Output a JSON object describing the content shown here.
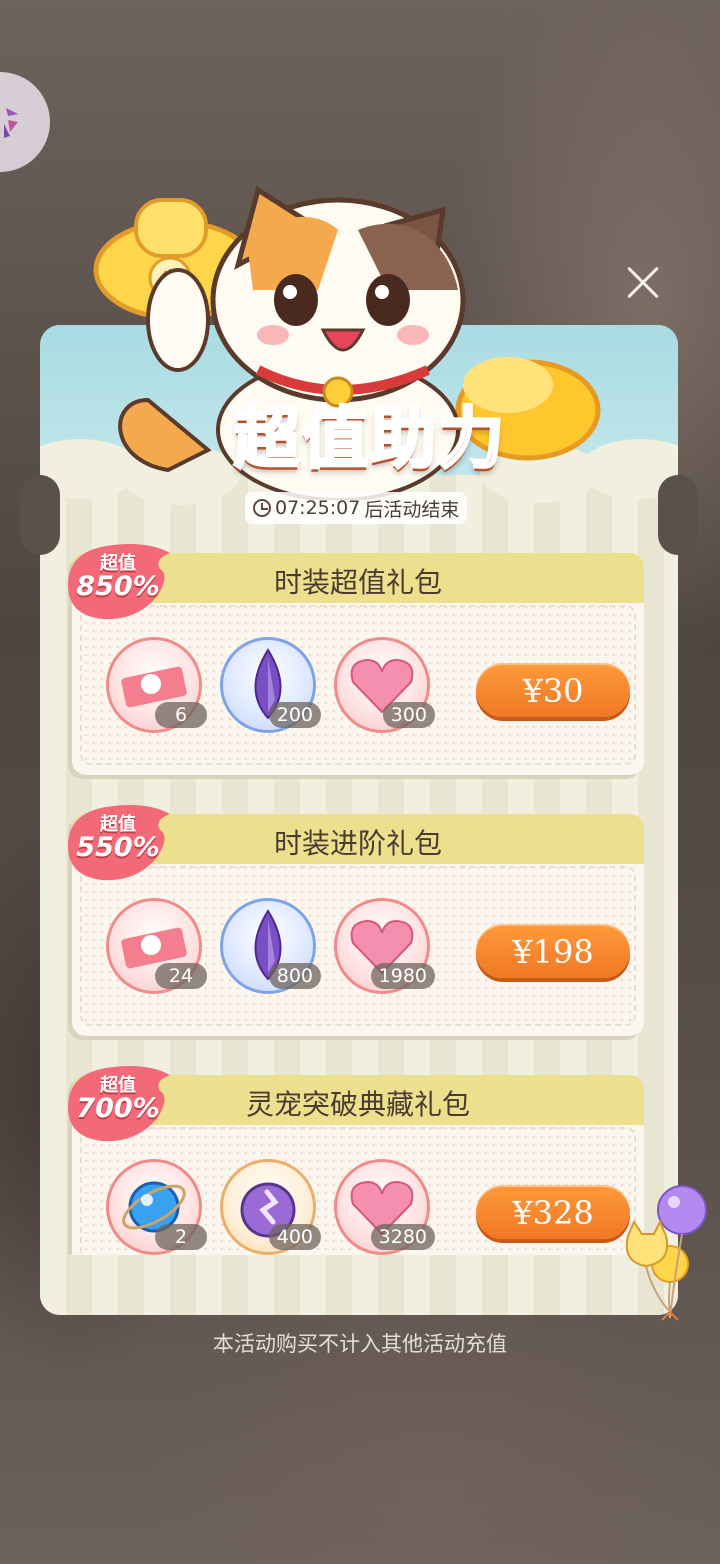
{
  "title": "超值助力",
  "timer": {
    "time": "07:25:07",
    "suffix": "后活动结束"
  },
  "packs": [
    {
      "name": "时装超值礼包",
      "badge_top": "超值",
      "badge_pct": "850%",
      "items": [
        {
          "icon": "fashion-ticket-icon",
          "count": "6"
        },
        {
          "icon": "purple-crystal-icon",
          "count": "200"
        },
        {
          "icon": "pink-heart-gem-icon",
          "count": "300"
        }
      ],
      "price": "¥30"
    },
    {
      "name": "时装进阶礼包",
      "badge_top": "超值",
      "badge_pct": "550%",
      "items": [
        {
          "icon": "fashion-ticket-icon",
          "count": "24"
        },
        {
          "icon": "purple-crystal-icon",
          "count": "800"
        },
        {
          "icon": "pink-heart-gem-icon",
          "count": "1980"
        }
      ],
      "price": "¥198"
    },
    {
      "name": "灵宠突破典藏礼包",
      "badge_top": "超值",
      "badge_pct": "700%",
      "items": [
        {
          "icon": "blue-orb-icon",
          "count": "2"
        },
        {
          "icon": "purple-potion-icon",
          "count": "400"
        },
        {
          "icon": "pink-heart-gem-icon",
          "count": "3280"
        }
      ],
      "price": "¥328"
    }
  ],
  "footer_note": "本活动购买不计入其他活动充值",
  "colors": {
    "accent": "#f07825",
    "header": "#ece08f",
    "badge": "#f26a78"
  }
}
